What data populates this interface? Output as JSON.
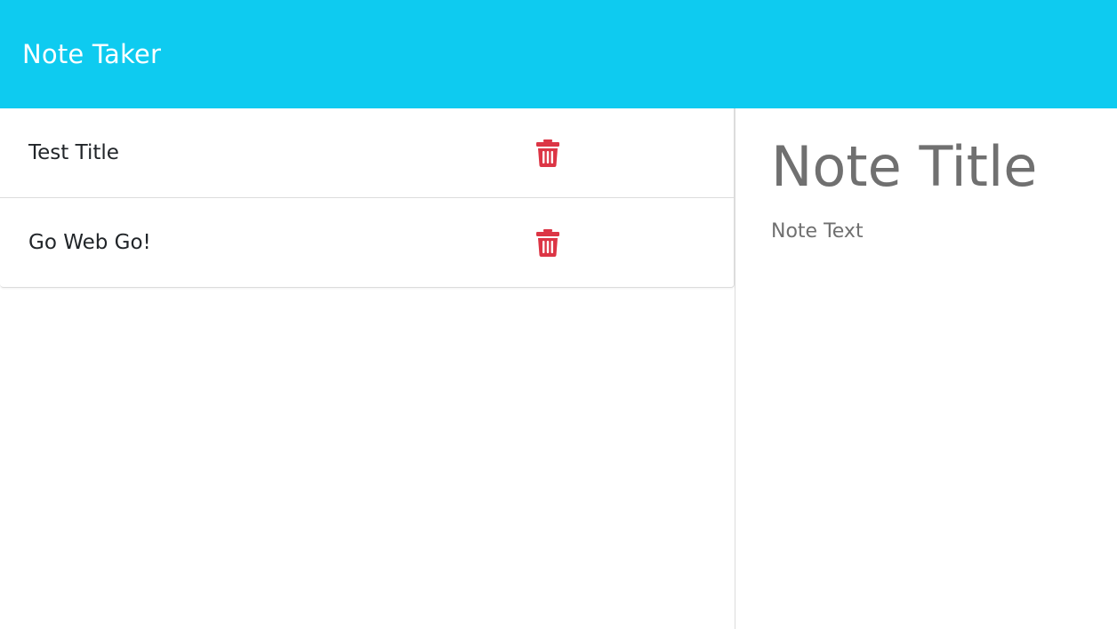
{
  "navbar": {
    "brand": "Note Taker",
    "background_color": "#0ecbf0"
  },
  "notes": [
    {
      "title": "Test Title",
      "delete_icon": "trash-icon"
    },
    {
      "title": "Go Web Go!",
      "delete_icon": "trash-icon"
    }
  ],
  "editor": {
    "title_placeholder": "Note Title",
    "text_placeholder": "Note Text"
  },
  "colors": {
    "delete_icon": "#dc3545"
  }
}
